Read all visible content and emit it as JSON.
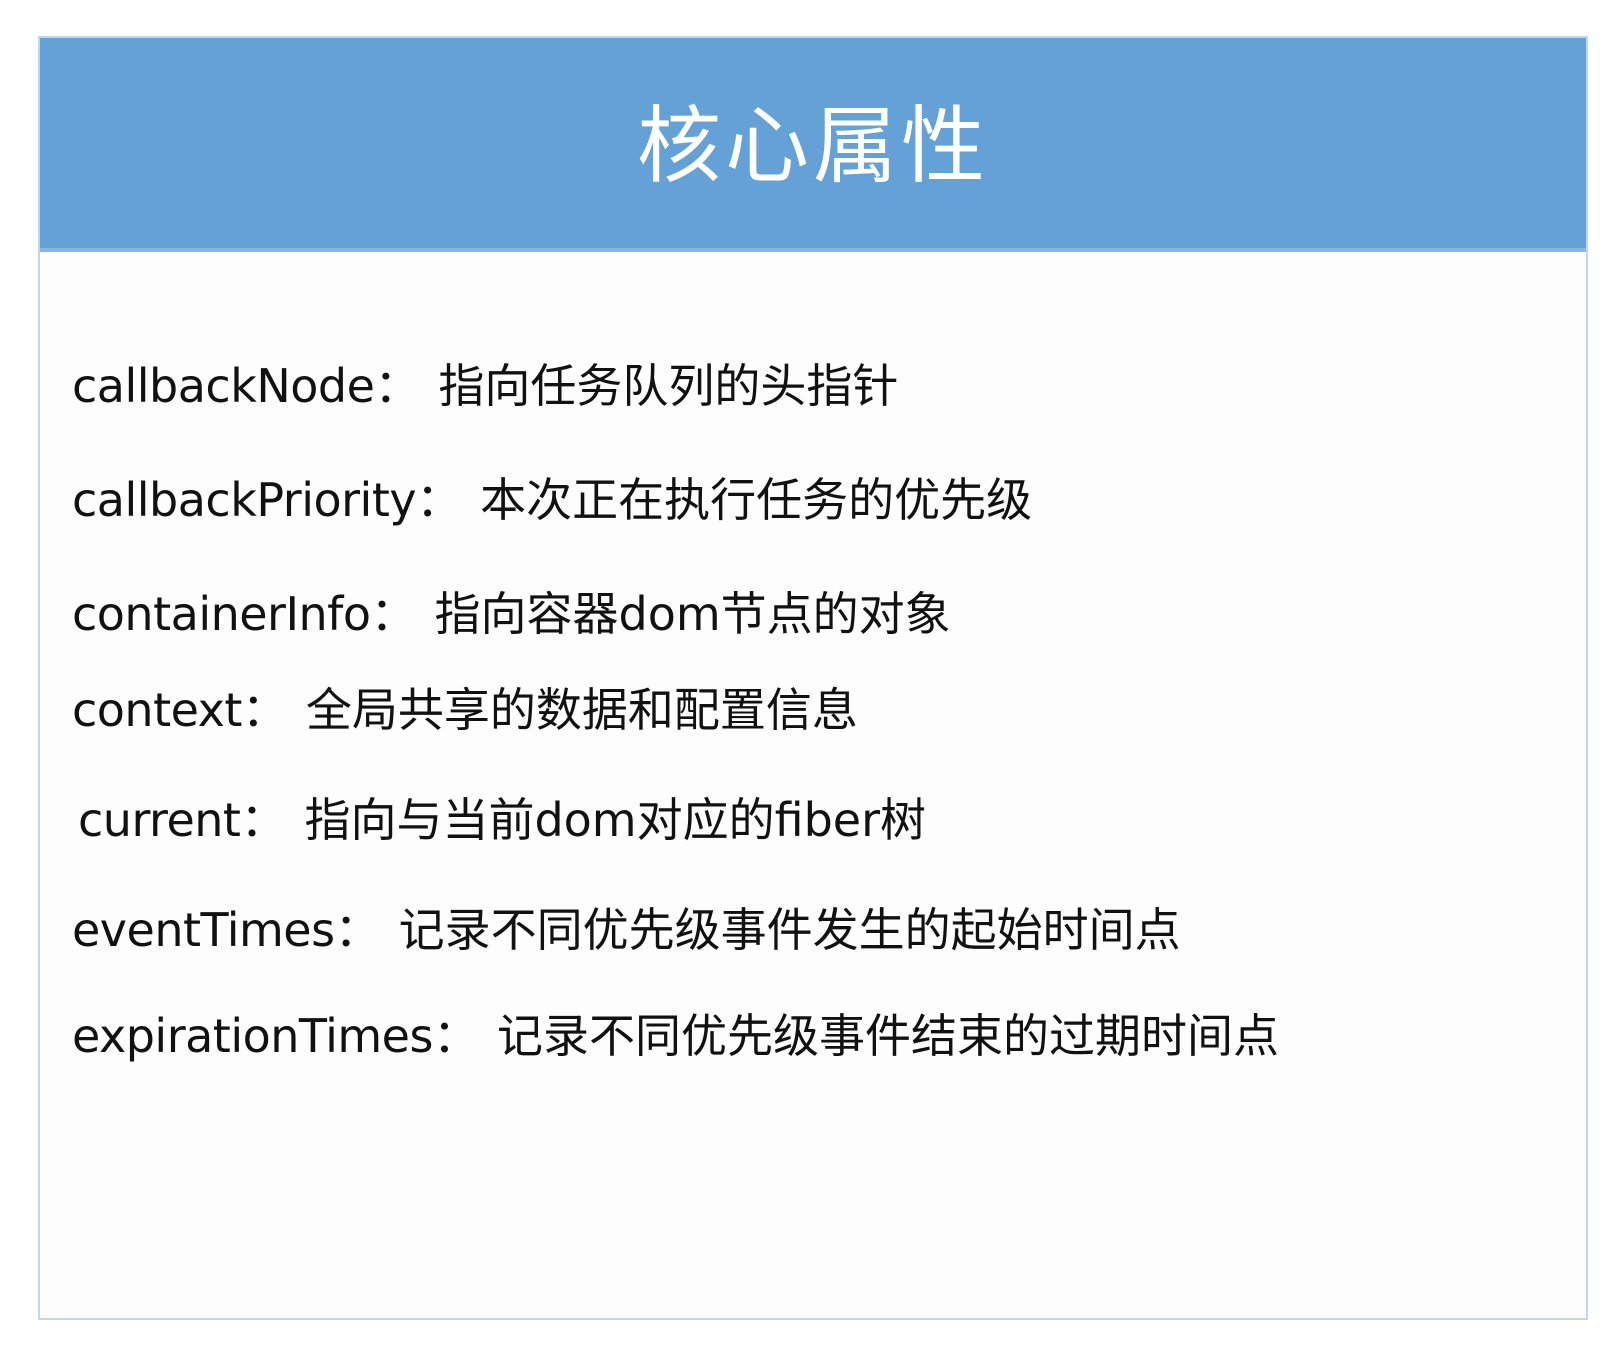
{
  "title": "核心属性",
  "properties": [
    {
      "name": "callbackNode",
      "sep": "：",
      "desc": "指向任务队列的头指针"
    },
    {
      "name": "callbackPriority",
      "sep": "：",
      "desc": "本次正在执行任务的优先级"
    },
    {
      "name": "containerInfo",
      "sep": "：",
      "desc": "指向容器dom节点的对象"
    },
    {
      "name": "context",
      "sep": "：",
      "desc": "全局共享的数据和配置信息"
    },
    {
      "name": "current",
      "sep": "：",
      "desc": "指向与当前dom对应的fiber树"
    },
    {
      "name": "eventTimes",
      "sep": "：",
      "desc": "记录不同优先级事件发生的起始时间点"
    },
    {
      "name": "expirationTimes",
      "sep": "：",
      "desc": "记录不同优先级事件结束的过期时间点"
    }
  ]
}
